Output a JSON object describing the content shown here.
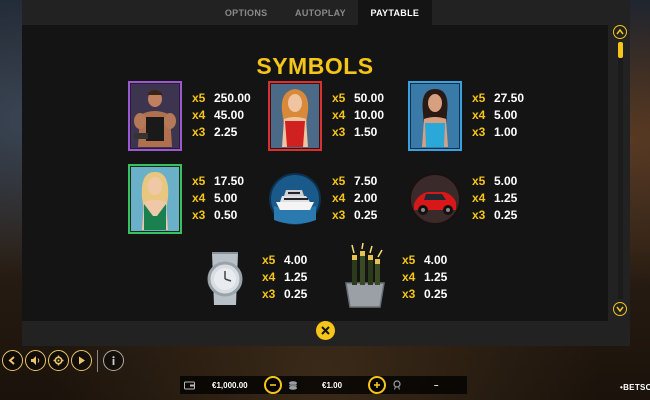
{
  "tabs": [
    {
      "label": "OPTIONS",
      "active": false
    },
    {
      "label": "AUTOPLAY",
      "active": false
    },
    {
      "label": "PAYTABLE",
      "active": true
    }
  ],
  "title": "SYMBOLS",
  "symbols": [
    {
      "icon": "bodybuilder-man-icon",
      "pays": [
        {
          "mult": "x5",
          "amount": "250.00"
        },
        {
          "mult": "x4",
          "amount": "45.00"
        },
        {
          "mult": "x3",
          "amount": "2.25"
        }
      ]
    },
    {
      "icon": "woman-red-swimsuit-icon",
      "pays": [
        {
          "mult": "x5",
          "amount": "50.00"
        },
        {
          "mult": "x4",
          "amount": "10.00"
        },
        {
          "mult": "x3",
          "amount": "1.50"
        }
      ]
    },
    {
      "icon": "woman-blue-dress-icon",
      "pays": [
        {
          "mult": "x5",
          "amount": "27.50"
        },
        {
          "mult": "x4",
          "amount": "5.00"
        },
        {
          "mult": "x3",
          "amount": "1.00"
        }
      ]
    },
    {
      "icon": "woman-green-dress-icon",
      "pays": [
        {
          "mult": "x5",
          "amount": "17.50"
        },
        {
          "mult": "x4",
          "amount": "5.00"
        },
        {
          "mult": "x3",
          "amount": "0.50"
        }
      ]
    },
    {
      "icon": "yacht-icon",
      "pays": [
        {
          "mult": "x5",
          "amount": "7.50"
        },
        {
          "mult": "x4",
          "amount": "2.00"
        },
        {
          "mult": "x3",
          "amount": "0.25"
        }
      ]
    },
    {
      "icon": "sports-car-icon",
      "pays": [
        {
          "mult": "x5",
          "amount": "5.00"
        },
        {
          "mult": "x4",
          "amount": "1.25"
        },
        {
          "mult": "x3",
          "amount": "0.25"
        }
      ]
    },
    {
      "icon": "wristwatch-icon",
      "pays": [
        {
          "mult": "x5",
          "amount": "4.00"
        },
        {
          "mult": "x4",
          "amount": "1.25"
        },
        {
          "mult": "x3",
          "amount": "0.25"
        }
      ]
    },
    {
      "icon": "champagne-bucket-icon",
      "pays": [
        {
          "mult": "x5",
          "amount": "4.00"
        },
        {
          "mult": "x4",
          "amount": "1.25"
        },
        {
          "mult": "x3",
          "amount": "0.25"
        }
      ]
    }
  ],
  "bottom": {
    "balance": "€1,000.00",
    "bet": "€1.00",
    "win": "–",
    "logo": "•BETSOFT•"
  },
  "colors": {
    "accent": "#f5c518",
    "panel": "#222222",
    "content": "#141414"
  }
}
